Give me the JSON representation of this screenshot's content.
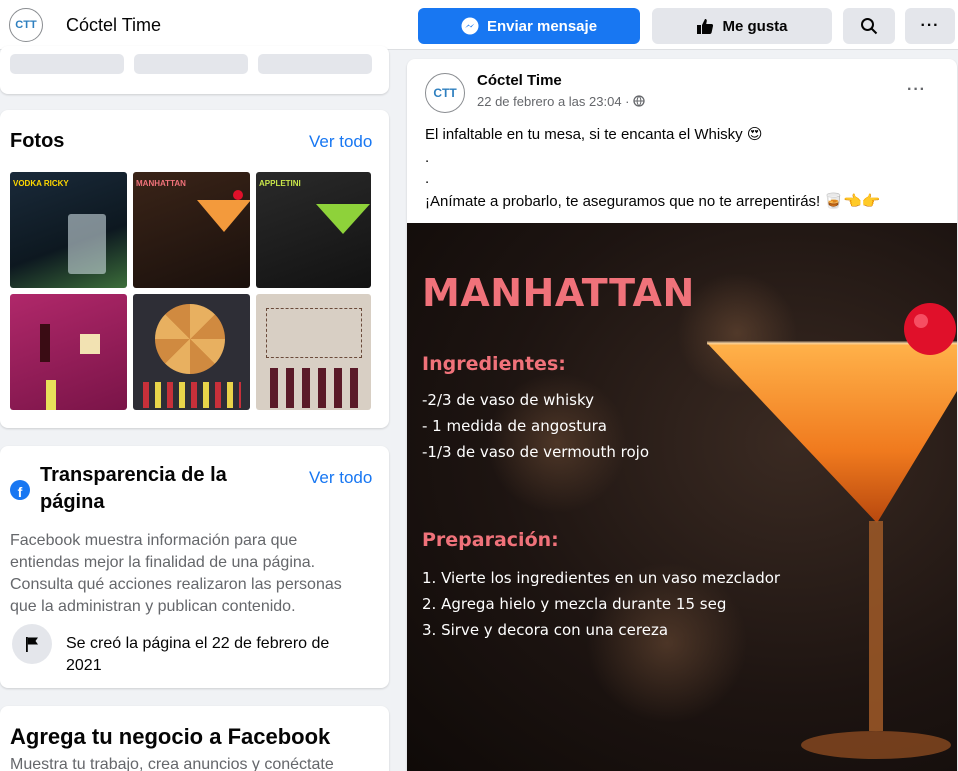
{
  "header": {
    "logo_text": "CTT",
    "page_name": "Cóctel Time",
    "send_message_label": "Enviar mensaje",
    "like_label": "Me gusta",
    "more_label": "···"
  },
  "photos": {
    "title": "Fotos",
    "see_all": "Ver todo",
    "thumbs": [
      {
        "label": "VODKA RICKY"
      },
      {
        "label": "MANHATTAN"
      },
      {
        "label": "APPLETINI"
      }
    ]
  },
  "transparency": {
    "title": "Transparencia de la página",
    "see_all": "Ver todo",
    "description": "Facebook muestra información para que entiendas mejor la finalidad de una página. Consulta qué acciones realizaron las personas que la administran y publican contenido.",
    "created": "Se creó la página el 22 de febrero de 2021"
  },
  "business": {
    "title": "Agrega tu negocio a Facebook",
    "description": "Muestra tu trabajo, crea anuncios y conéctate"
  },
  "post": {
    "author": "Cóctel Time",
    "date": "22 de febrero a las 23:04 ·",
    "more_label": "···",
    "line1": "El infaltable en tu mesa, si te encanta el Whisky 😍",
    "dot1": ".",
    "dot2": ".",
    "line4": "¡Anímate a probarlo, te aseguramos que no te arrepentirás! 🥃👈👉",
    "image": {
      "title": "MANHATTAN",
      "ingredients_heading": "Ingredientes:",
      "ingredients": [
        "-2/3 de vaso de whisky",
        "- 1 medida de angostura",
        "-1/3 de vaso de vermouth rojo"
      ],
      "prep_heading": "Preparación:",
      "steps": [
        "1. Vierte los ingredientes en un vaso mezclador",
        "2. Agrega hielo y mezcla durante 15 seg",
        "3. Sirve y decora con una cereza"
      ]
    }
  },
  "colors": {
    "accent": "#1877f2",
    "heading_pink": "#f0727a"
  }
}
